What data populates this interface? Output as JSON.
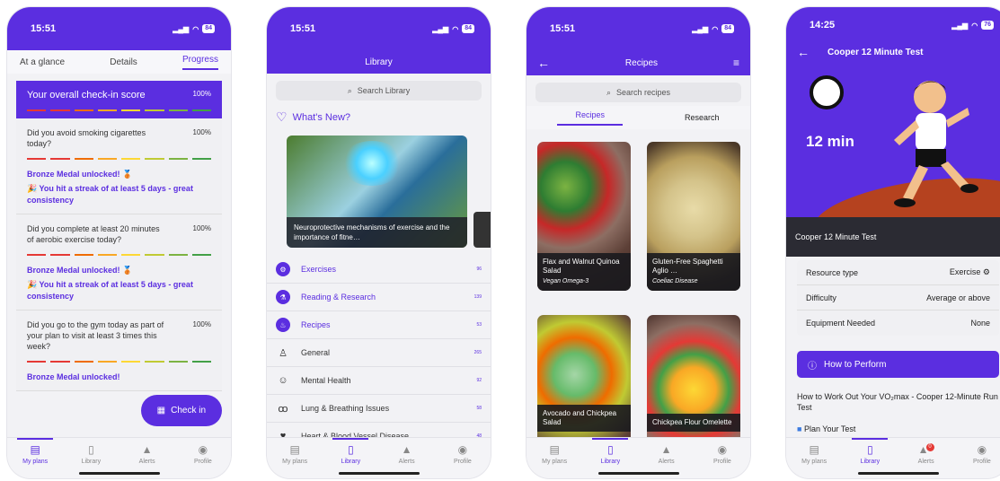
{
  "colors": {
    "accent": "#5b2ee0",
    "dashes": [
      "#e53935",
      "#e53935",
      "#ef6c00",
      "#f9a825",
      "#fdd835",
      "#c0ca33",
      "#7cb342",
      "#43a047"
    ]
  },
  "nav": {
    "plans": "My plans",
    "library": "Library",
    "alerts": "Alerts",
    "profile": "Profile"
  },
  "p1": {
    "time": "15:51",
    "battery": "84",
    "tabs": [
      "At a glance",
      "Details",
      "Progress"
    ],
    "overall": "Your overall check-in score",
    "overall_pct": "100%",
    "items": [
      {
        "q": "Did you avoid smoking cigarettes today?",
        "pct": "100%",
        "medal": "Bronze Medal unlocked! 🥉",
        "streak": "🎉 You hit a streak of at least 5 days - great consistency"
      },
      {
        "q": "Did you complete at least 20 minutes of aerobic exercise today?",
        "pct": "100%",
        "medal": "Bronze Medal unlocked! 🥉",
        "streak": "🎉 You hit a streak of at least 5 days - great consistency"
      },
      {
        "q": "Did you go to the gym today as part of your plan to visit at least 3 times this week?",
        "pct": "100%",
        "medal": "Bronze Medal unlocked!"
      }
    ],
    "checkin": "Check in"
  },
  "p2": {
    "time": "15:51",
    "battery": "84",
    "title": "Library",
    "search": "Search Library",
    "whatsnew": "What's New?",
    "hero_caption": "Neuroprotective mechanisms of exercise and the importance of fitne…",
    "list": [
      {
        "name": "Exercises",
        "count": "96"
      },
      {
        "name": "Reading & Research",
        "count": "139"
      },
      {
        "name": "Recipes",
        "count": "53"
      },
      {
        "name": "General",
        "count": "265"
      },
      {
        "name": "Mental Health",
        "count": "92"
      },
      {
        "name": "Lung & Breathing Issues",
        "count": "58"
      },
      {
        "name": "Heart & Blood Vessel Disease",
        "count": "48"
      }
    ]
  },
  "p3": {
    "time": "15:51",
    "battery": "84",
    "title": "Recipes",
    "search": "Search recipes",
    "tabs": [
      "Recipes",
      "Research"
    ],
    "cards": [
      {
        "name": "Flax and Walnut Quinoa Salad",
        "tag": "Vegan Omega-3"
      },
      {
        "name": "Gluten-Free Spaghetti Aglio …",
        "tag": "Coeliac Disease"
      },
      {
        "name": "Avocado and Chickpea Salad",
        "tag": ""
      },
      {
        "name": "Chickpea Flour Omelette",
        "tag": ""
      }
    ]
  },
  "p4": {
    "time": "14:25",
    "battery": "76",
    "title": "Cooper 12 Minute Test",
    "hero_text": "12 min",
    "bar_title": "Cooper 12 Minute Test",
    "rows": [
      {
        "k": "Resource type",
        "v": "Exercise"
      },
      {
        "k": "Difficulty",
        "v": "Average or above"
      },
      {
        "k": "Equipment Needed",
        "v": "None"
      }
    ],
    "how": "How to Perform",
    "desc": "How to Work Out Your VO₂max - Cooper 12-Minute Run Test",
    "plan": "Plan Your Test",
    "alert_badge": "0"
  }
}
